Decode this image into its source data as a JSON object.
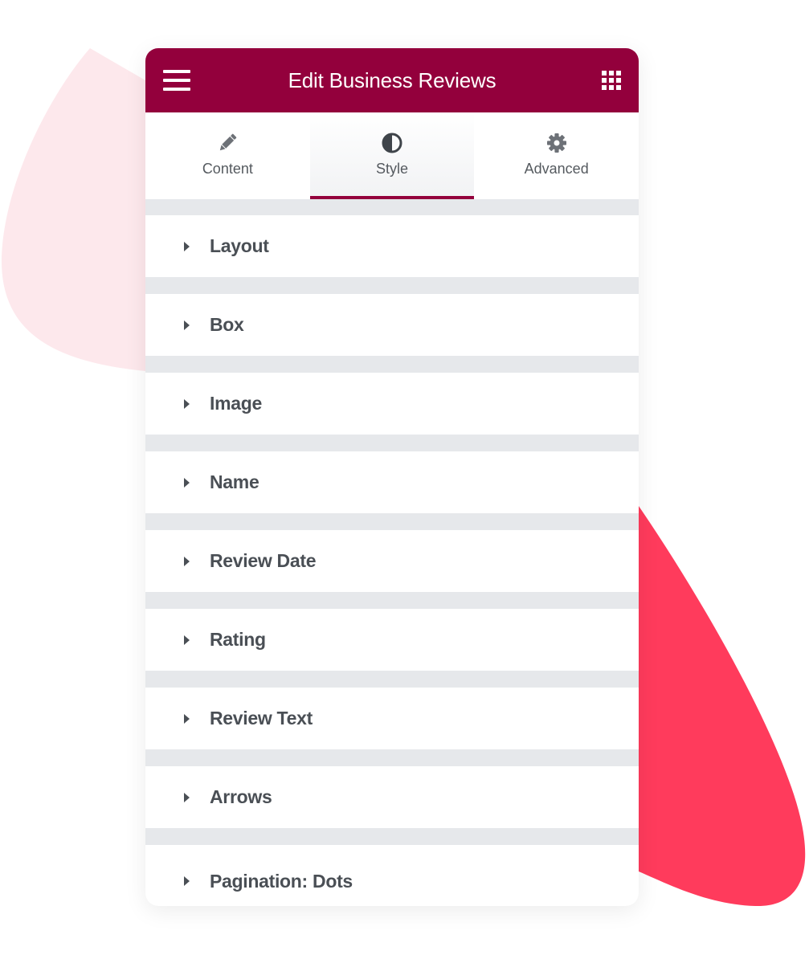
{
  "colors": {
    "brand": "#93003c",
    "accent_shape": "#ff3b5c",
    "accent_shape_light": "#fde8ec",
    "section_text": "#4a4f55",
    "divider": "#e6e8eb"
  },
  "header": {
    "title": "Edit Business Reviews",
    "menu_icon": "hamburger-menu-icon",
    "apps_icon": "grid-apps-icon"
  },
  "tabs": [
    {
      "label": "Content",
      "icon": "pencil-icon",
      "active": false
    },
    {
      "label": "Style",
      "icon": "half-circle-contrast-icon",
      "active": true
    },
    {
      "label": "Advanced",
      "icon": "gear-icon",
      "active": false
    }
  ],
  "sections": [
    {
      "label": "Layout"
    },
    {
      "label": "Box"
    },
    {
      "label": "Image"
    },
    {
      "label": "Name"
    },
    {
      "label": "Review Date"
    },
    {
      "label": "Rating"
    },
    {
      "label": "Review Text"
    },
    {
      "label": "Arrows"
    },
    {
      "label": "Pagination: Dots"
    }
  ]
}
